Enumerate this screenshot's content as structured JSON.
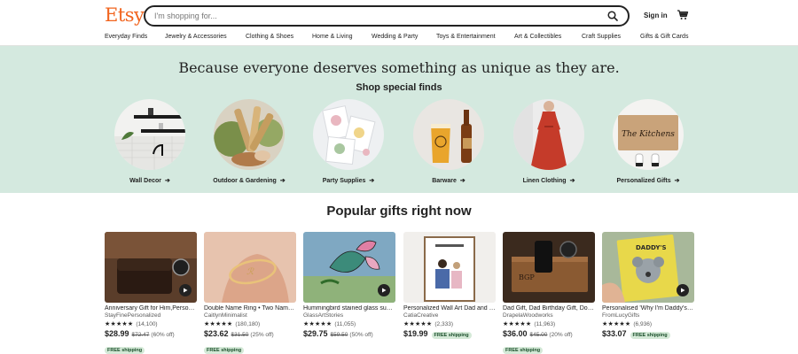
{
  "header": {
    "logo": "Etsy",
    "search_placeholder": "I'm shopping for...",
    "signin": "Sign in"
  },
  "nav": [
    "Everyday Finds",
    "Jewelry & Accessories",
    "Clothing & Shoes",
    "Home & Living",
    "Wedding & Party",
    "Toys & Entertainment",
    "Art & Collectibles",
    "Craft Supplies",
    "Gifts & Gift Cards"
  ],
  "hero": {
    "title": "Because everyone deserves something as unique as they are.",
    "subtitle": "Shop special finds",
    "arrow": "➔",
    "categories": [
      {
        "label": "Wall Decor"
      },
      {
        "label": "Outdoor & Gardening"
      },
      {
        "label": "Party Supplies"
      },
      {
        "label": "Barware"
      },
      {
        "label": "Linen Clothing"
      },
      {
        "label": "Personalized Gifts",
        "doormat_text": "The Kitchens"
      }
    ]
  },
  "popular": {
    "title": "Popular gifts right now",
    "stars": "★★★★★",
    "items": [
      {
        "title": "Anniversary Gift for Him,Personalized...",
        "shop": "StayFinePersonalized",
        "reviews": "(14,100)",
        "price": "$28.99",
        "original": "$72.47",
        "discount": "(60% off)",
        "shipping": "FREE shipping"
      },
      {
        "title": "Double Name Ring • Two Name Ring",
        "shop": "CaitlynMinimalist",
        "reviews": "(180,180)",
        "price": "$23.62",
        "original": "$31.50",
        "discount": "(25% off)",
        "shipping": "FREE shipping"
      },
      {
        "title": "Hummingbird stained glass suncatcher",
        "shop": "GlassArtStories",
        "reviews": "(11,055)",
        "price": "$29.75",
        "original": "$59.50",
        "discount": "(50% off)",
        "shipping": ""
      },
      {
        "title": "Personalized Wall Art Dad and kids",
        "shop": "CatiaCreative",
        "reviews": "(2,333)",
        "price": "$19.99",
        "original": "",
        "discount": "",
        "shipping": "FREE shipping"
      },
      {
        "title": "Dad Gift, Dad Birthday Gift, Docking Station",
        "shop": "DrapelaWoodworks",
        "reviews": "(11,963)",
        "price": "$36.00",
        "original": "$45.00",
        "discount": "(20% off)",
        "shipping": "FREE shipping"
      },
      {
        "title": "Personalised 'Why I'm Daddy's Girl' Book",
        "shop": "FromLucyGifts",
        "reviews": "(6,936)",
        "price": "$33.07",
        "original": "",
        "discount": "",
        "shipping": "FREE shipping"
      }
    ]
  },
  "colors": {
    "brand": "#F1641E",
    "hero_bg": "#D4E9DF",
    "shipping_badge": "#D4E9D7"
  }
}
